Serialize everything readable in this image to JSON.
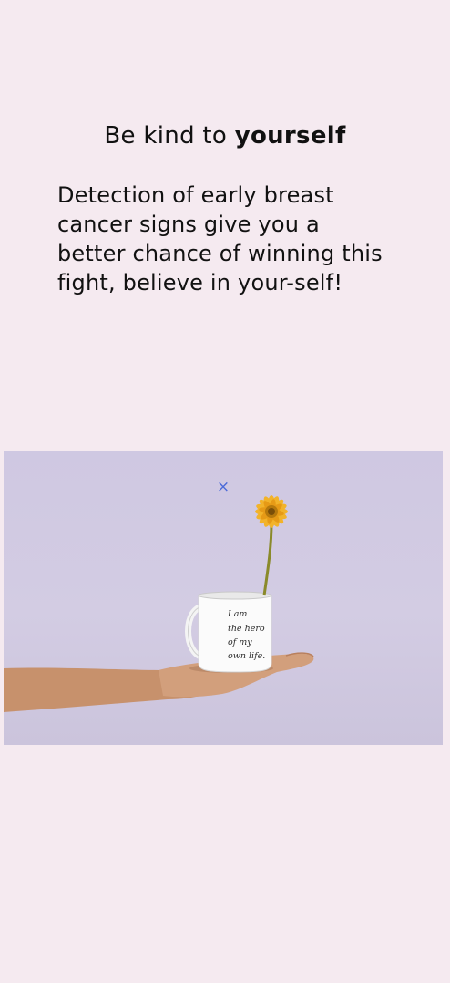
{
  "promo": {
    "headline_regular": "Be kind to ",
    "headline_bold": "yourself",
    "message": "Detection of early breast cancer signs give you a better chance of winning this fight, believe in your-self!"
  },
  "photo": {
    "mug_text_lines": [
      "I am",
      "the hero",
      "of my",
      "own life."
    ]
  },
  "close": {
    "glyph": "×"
  },
  "colors": {
    "background": "#f5eaf0",
    "photo_background": "#d1cae2",
    "close_icon": "#4a6ad8",
    "flower": "#f2b32a"
  }
}
